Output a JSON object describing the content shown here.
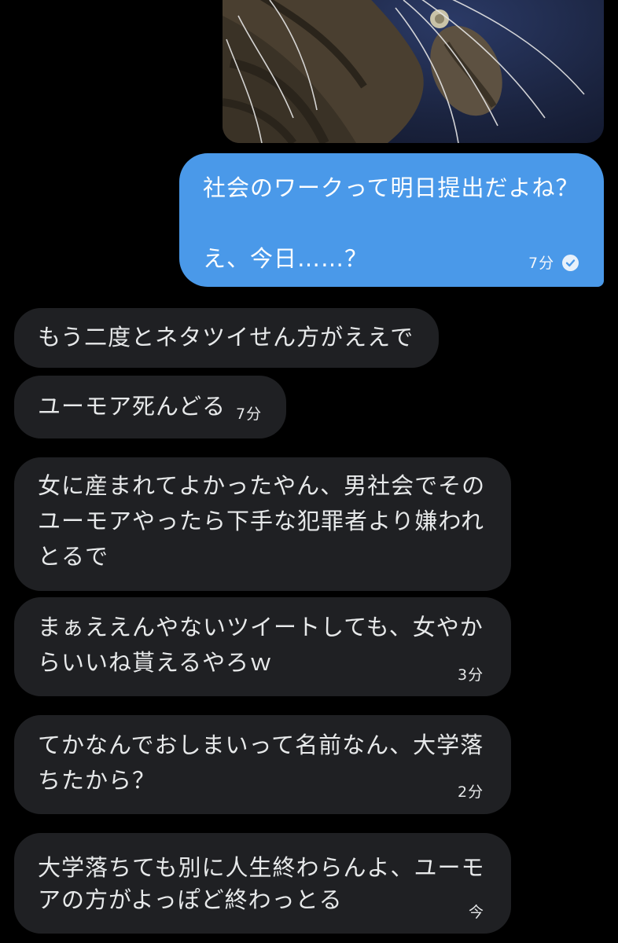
{
  "sent": {
    "lines": [
      "社会のワークって明日提出だよね？",
      "",
      "え、今日……？"
    ],
    "time": "7分",
    "status_icon": "read-check-icon"
  },
  "received": [
    {
      "lines": [
        "もう二度とネタツイせん方がええで"
      ]
    },
    {
      "lines": [
        "ユーモア死んどる"
      ],
      "time": "7分"
    },
    {
      "lines": [
        "女に産まれてよかったやん、男社会でその",
        "ユーモアやったら下手な犯罪者より嫌われ",
        "とるで"
      ]
    },
    {
      "lines": [
        "まぁええんやないツイートしても、女やか",
        "らいいね貰えるやろｗ"
      ],
      "time": "3分"
    },
    {
      "lines": [
        "てかなんでおしまいって名前なん、大学落",
        "ちたから？"
      ],
      "time": "2分"
    },
    {
      "lines": [
        "大学落ちても別に人生終わらんよ、ユーモ",
        "アの方がよっぽど終わっとる"
      ],
      "time": "今"
    }
  ],
  "colors": {
    "background": "#000000",
    "sent_bubble": "#4a99e9",
    "received_bubble": "#1f2023",
    "text": "#e7e9ea"
  }
}
